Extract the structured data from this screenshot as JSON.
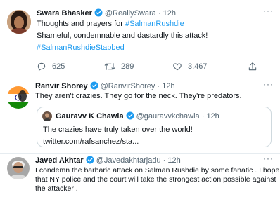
{
  "tweets": [
    {
      "name": "Swara Bhasker",
      "handle": "@ReallySwara",
      "time": "12h",
      "lines": [
        {
          "text": "Thoughts and prayers for ",
          "tag": "#SalmanRushdie"
        },
        {
          "text": "Shameful, condemnable and dastardly this attack!",
          "tag": ""
        },
        {
          "text": "",
          "tag": "#SalmanRushdieStabbed"
        }
      ],
      "actions": {
        "replies": "625",
        "retweets": "289",
        "likes": "3,467"
      }
    },
    {
      "name": "Ranvir Shorey",
      "handle": "@RanvirShorey",
      "time": "12h",
      "text": "They aren't crazies. They go for the neck. They're predators.",
      "quote": {
        "name": "Gauravv K Chawla",
        "handle": "@gauravvkchawla",
        "time": "12h",
        "line1": "The crazies have truly taken over the world!",
        "line2": "twitter.com/rafsanchez/sta..."
      }
    },
    {
      "name": "Javed Akhtar",
      "handle": "@Javedakhtarjadu",
      "time": "12h",
      "lines": [
        "I condemn the barbaric attack on Salman Rushdie  by some fanatic . I hope",
        "that NY police and the court will take the strongest action possible against",
        "the attacker ."
      ]
    }
  ],
  "separator": "·",
  "colors": {
    "accent": "#1d9bf0",
    "muted": "#536471",
    "text": "#0f1419",
    "border": "#cfd9de"
  },
  "icons": [
    "verified-badge-icon",
    "more-icon",
    "reply-icon",
    "retweet-icon",
    "like-icon",
    "share-icon"
  ]
}
